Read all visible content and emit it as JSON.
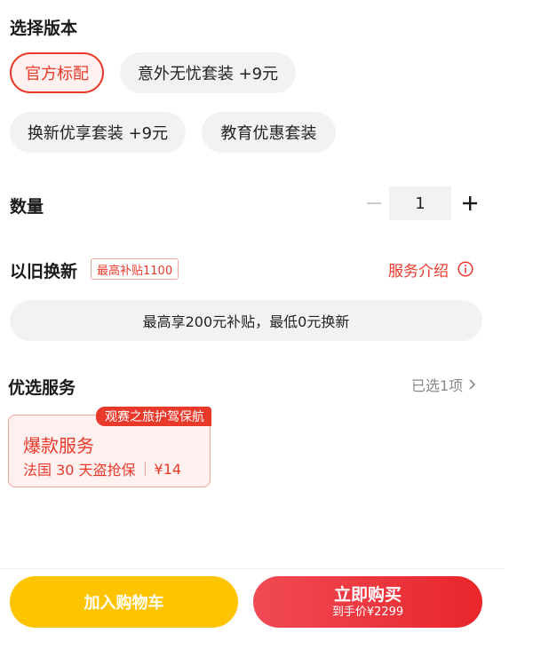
{
  "version": {
    "title": "选择版本",
    "options": [
      {
        "label": "官方标配",
        "selected": true
      },
      {
        "label": "意外无忧套装 +9元",
        "selected": false
      },
      {
        "label": "换新优享套装 +9元",
        "selected": false
      },
      {
        "label": "教育优惠套装",
        "selected": false
      }
    ]
  },
  "quantity": {
    "title": "数量",
    "value": "1"
  },
  "trade_in": {
    "title": "以旧换新",
    "badge": "最高补贴1100",
    "service_link": "服务介绍",
    "banner": "最高享200元补贴，最低0元换新"
  },
  "services": {
    "title": "优选服务",
    "selected_count": "已选1项",
    "card": {
      "promo_tag": "观赛之旅护驾保航",
      "title": "爆款服务",
      "desc": "法国 30 天盗抢保",
      "price": "¥14"
    }
  },
  "footer": {
    "cart_label": "加入购物车",
    "buy_label": "立即购买",
    "buy_price": "到手价¥2299"
  },
  "colors": {
    "accent": "#e8392b",
    "cart": "#ffc400",
    "buy": "#e8262b"
  }
}
